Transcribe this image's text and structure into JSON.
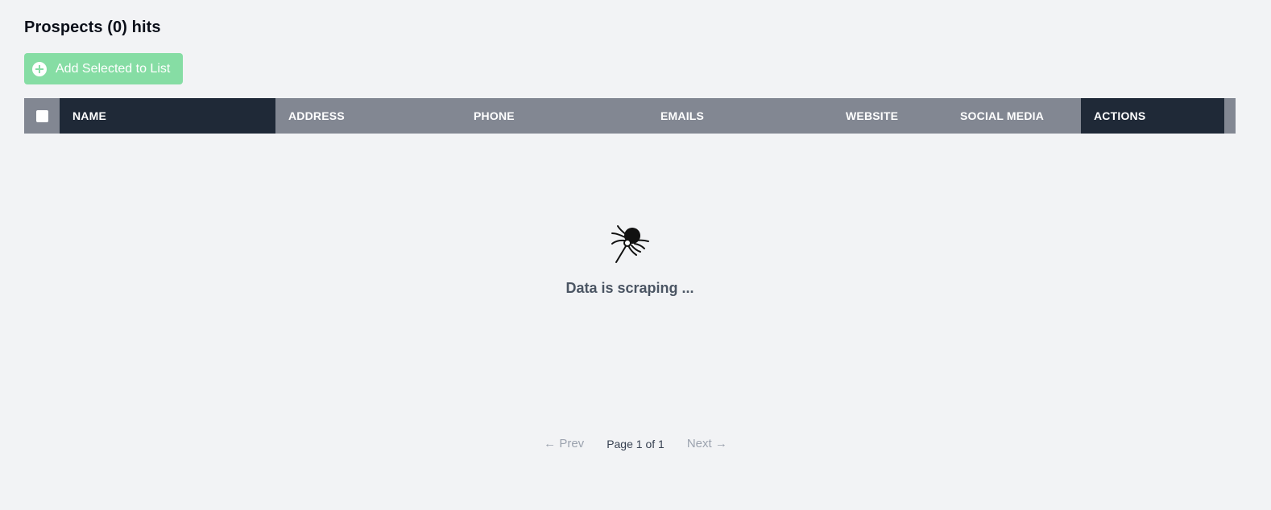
{
  "page": {
    "title": "Prospects (0) hits"
  },
  "toolbar": {
    "add_selected_label": "Add Selected to List",
    "add_icon": "plus-circle-icon",
    "accent": "#86dda4"
  },
  "table": {
    "columns": {
      "name": "NAME",
      "address": "ADDRESS",
      "phone": "PHONE",
      "emails": "EMAILS",
      "website": "WEBSITE",
      "social_media": "SOCIAL MEDIA",
      "actions": "ACTIONS"
    },
    "header_dark": "#1f2937",
    "header_gray": "#828792",
    "rows": [],
    "empty_state": {
      "icon": "spider-icon",
      "message": "Data is scraping ..."
    }
  },
  "pagination": {
    "prev_label": "← Prev",
    "page_info": "Page 1 of 1",
    "next_label": "Next →"
  }
}
